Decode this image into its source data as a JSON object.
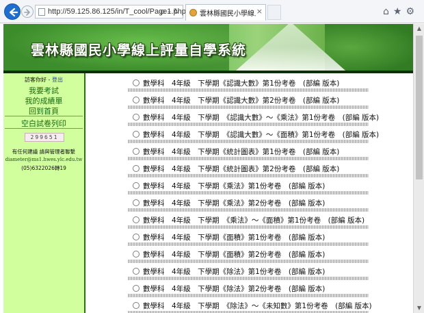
{
  "browser": {
    "url": "http://59.125.86.125/in/T_cool/Page1.php",
    "address_tools": "ρ – ↻",
    "tab_title": "雲林縣國民小學線上評量自...",
    "tab_close": "×",
    "toolbar_icons": "⌂★⚙"
  },
  "banner": {
    "title": "雲林縣國民小學線上評量自學系統"
  },
  "sidebar": {
    "greeting": "訪客你好",
    "separator": " - ",
    "logout": "登出",
    "links": [
      "我要考試",
      "我的成績單",
      "回到首頁",
      "空白試卷列印"
    ],
    "visit_counter": "299651",
    "contact_line": "有任何建議 請與管理者聯繫",
    "email": "diameter@ms1.hwes.ylc.edu.tw",
    "phone": "(05)6322026轉19"
  },
  "exams": [
    "數學科　4年級　下學期《認識大數》第1份考卷　(部編 版本)",
    "數學科　4年級　下學期《認識大數》第2份考卷　(部編 版本)",
    "數學科　4年級　下學期　《認識大數》～《乘法》第1份考卷　(部編 版本)",
    "數學科　4年級　下學期　《認識大數》～《面積》第1份考卷　(部編 版本)",
    "數學科　4年級　下學期《統計圖表》第1份考卷　(部編 版本)",
    "數學科　4年級　下學期《統計圖表》第2份考卷　(部編 版本)",
    "數學科　4年級　下學期《乘法》第1份考卷　(部編 版本)",
    "數學科　4年級　下學期《乘法》第2份考卷　(部編 版本)",
    "數學科　4年級　下學期　《乘法》～《面積》第1份考卷　(部編 版本)",
    "數學科　4年級　下學期《面積》第1份考卷　(部編 版本)",
    "數學科　4年級　下學期《面積》第2份考卷　(部編 版本)",
    "數學科　4年級　下學期《除法》第1份考卷　(部編 版本)",
    "數學科　4年級　下學期《除法》第2份考卷　(部編 版本)",
    "數學科　4年級　下學期　《除法》～《未知數》第1份考卷　(部編 版本)"
  ],
  "scrollbar": {
    "up_icon": "scroll-up-icon",
    "down_icon": "scroll-down-icon"
  }
}
